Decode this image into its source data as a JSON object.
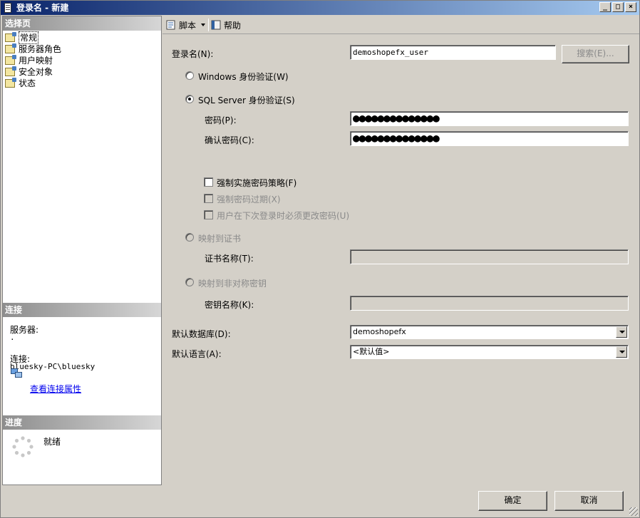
{
  "window": {
    "title": "登录名 - 新建",
    "controls": [
      "_",
      "□",
      "×"
    ]
  },
  "left": {
    "select_page_header": "选择页",
    "pages": [
      {
        "label": "常规",
        "selected": true
      },
      {
        "label": "服务器角色"
      },
      {
        "label": "用户映射"
      },
      {
        "label": "安全对象"
      },
      {
        "label": "状态"
      }
    ],
    "connection_header": "连接",
    "server_label": "服务器:",
    "server_value": ".",
    "connection_label": "连接:",
    "connection_value": "bluesky-PC\\bluesky",
    "view_props_link": "查看连接属性",
    "progress_header": "进度",
    "progress_status": "就绪"
  },
  "toolbar": {
    "script_label": "脚本",
    "help_label": "帮助"
  },
  "form": {
    "login_name_label": "登录名(N):",
    "login_name_value": "demoshopefx_user",
    "search_button": "搜索(E)...",
    "windows_auth_label": "Windows 身份验证(W)",
    "sql_auth_label": "SQL Server 身份验证(S)",
    "password_label": "密码(P):",
    "password_value": "●●●●●●●●●●●●●●",
    "confirm_password_label": "确认密码(C):",
    "confirm_password_value": "●●●●●●●●●●●●●●",
    "enforce_policy_label": "强制实施密码策略(F)",
    "enforce_expiration_label": "强制密码过期(X)",
    "must_change_label": "用户在下次登录时必须更改密码(U)",
    "map_cert_label": "映射到证书",
    "cert_name_label": "证书名称(T):",
    "map_asym_key_label": "映射到非对称密钥",
    "key_name_label": "密钥名称(K):",
    "default_db_label": "默认数据库(D):",
    "default_db_value": "demoshopefx",
    "default_lang_label": "默认语言(A):",
    "default_lang_value": "<默认值>"
  },
  "footer": {
    "ok_button": "确定",
    "cancel_button": "取消"
  }
}
